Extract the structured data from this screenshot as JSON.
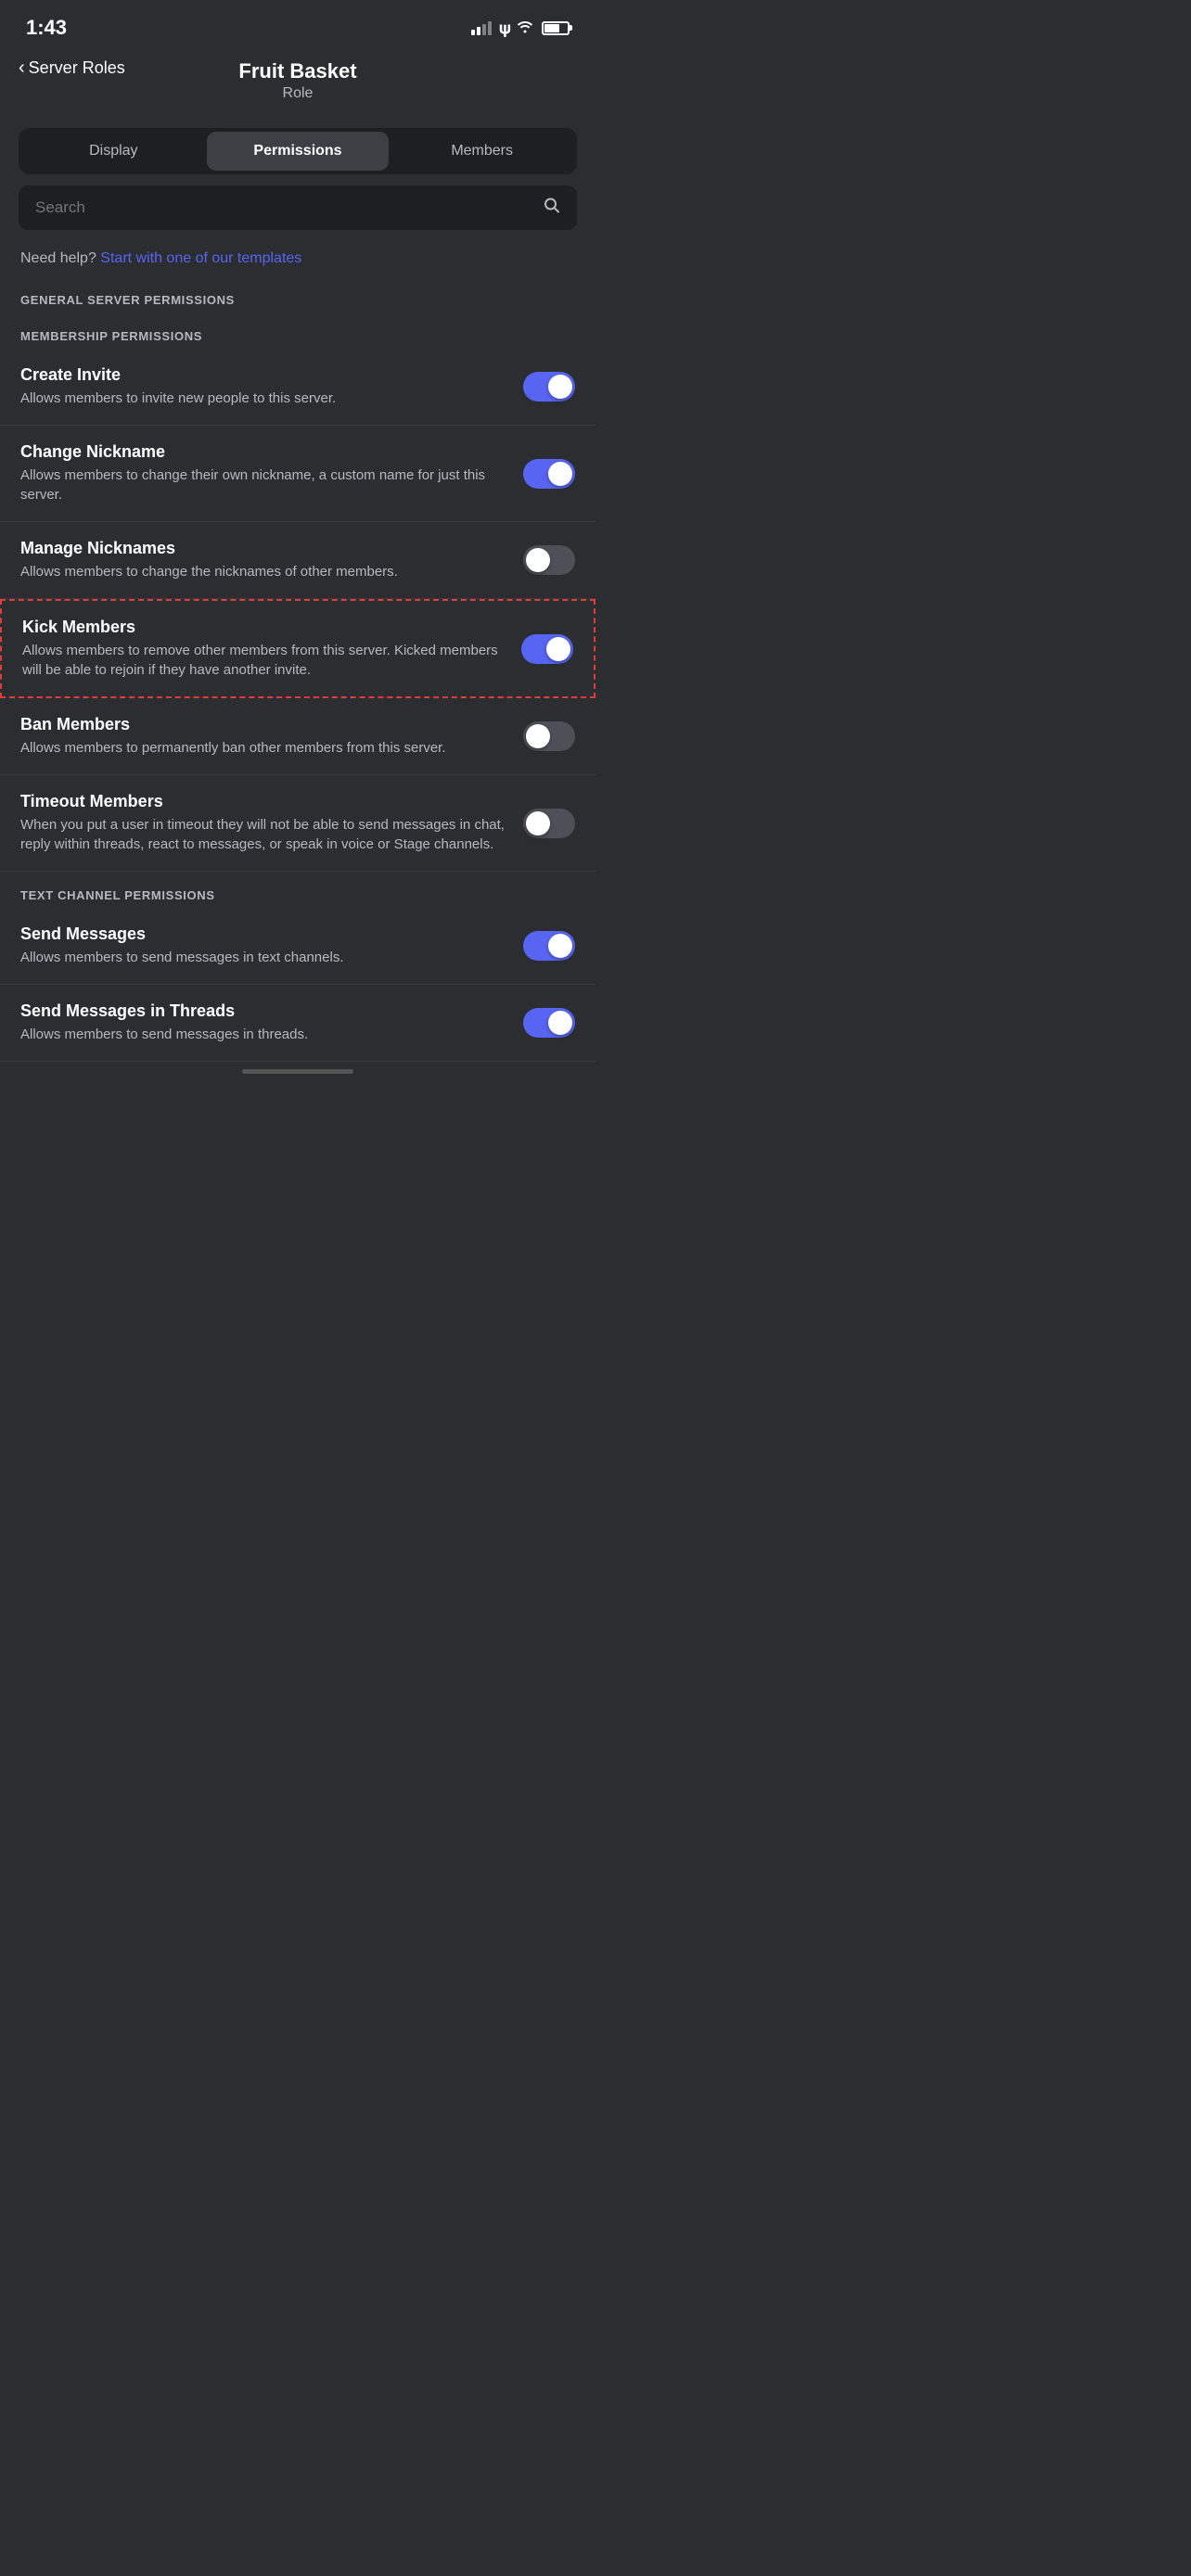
{
  "statusBar": {
    "time": "1:43"
  },
  "header": {
    "backLabel": "Server Roles",
    "title": "Fruit Basket",
    "subtitle": "Role"
  },
  "tabs": [
    {
      "id": "display",
      "label": "Display",
      "active": false
    },
    {
      "id": "permissions",
      "label": "Permissions",
      "active": true
    },
    {
      "id": "members",
      "label": "Members",
      "active": false
    }
  ],
  "search": {
    "placeholder": "Search"
  },
  "helpText": {
    "prefix": "Need help?",
    "linkLabel": "Start with one of our templates"
  },
  "sections": [
    {
      "id": "general-server",
      "header": "GENERAL SERVER PERMISSIONS",
      "subSections": [
        {
          "id": "membership",
          "header": "MEMBERSHIP PERMISSIONS",
          "items": [
            {
              "id": "create-invite",
              "title": "Create Invite",
              "description": "Allows members to invite new people to this server.",
              "enabled": true,
              "highlighted": false
            },
            {
              "id": "change-nickname",
              "title": "Change Nickname",
              "description": "Allows members to change their own nickname, a custom name for just this server.",
              "enabled": true,
              "highlighted": false
            },
            {
              "id": "manage-nicknames",
              "title": "Manage Nicknames",
              "description": "Allows members to change the nicknames of other members.",
              "enabled": false,
              "highlighted": false
            },
            {
              "id": "kick-members",
              "title": "Kick Members",
              "description": "Allows members to remove other members from this server. Kicked members will be able to rejoin if they have another invite.",
              "enabled": true,
              "highlighted": true
            },
            {
              "id": "ban-members",
              "title": "Ban Members",
              "description": "Allows members to permanently ban other members from this server.",
              "enabled": false,
              "highlighted": false
            },
            {
              "id": "timeout-members",
              "title": "Timeout Members",
              "description": "When you put a user in timeout they will not be able to send messages in chat, reply within threads, react to messages, or speak in voice or Stage channels.",
              "enabled": false,
              "highlighted": false
            }
          ]
        }
      ]
    },
    {
      "id": "text-channel",
      "header": "TEXT CHANNEL PERMISSIONS",
      "subSections": [],
      "items": [
        {
          "id": "send-messages",
          "title": "Send Messages",
          "description": "Allows members to send messages in text channels.",
          "enabled": true,
          "highlighted": false
        },
        {
          "id": "send-messages-threads",
          "title": "Send Messages in Threads",
          "description": "Allows members to send messages in threads.",
          "enabled": true,
          "highlighted": false
        }
      ]
    }
  ]
}
